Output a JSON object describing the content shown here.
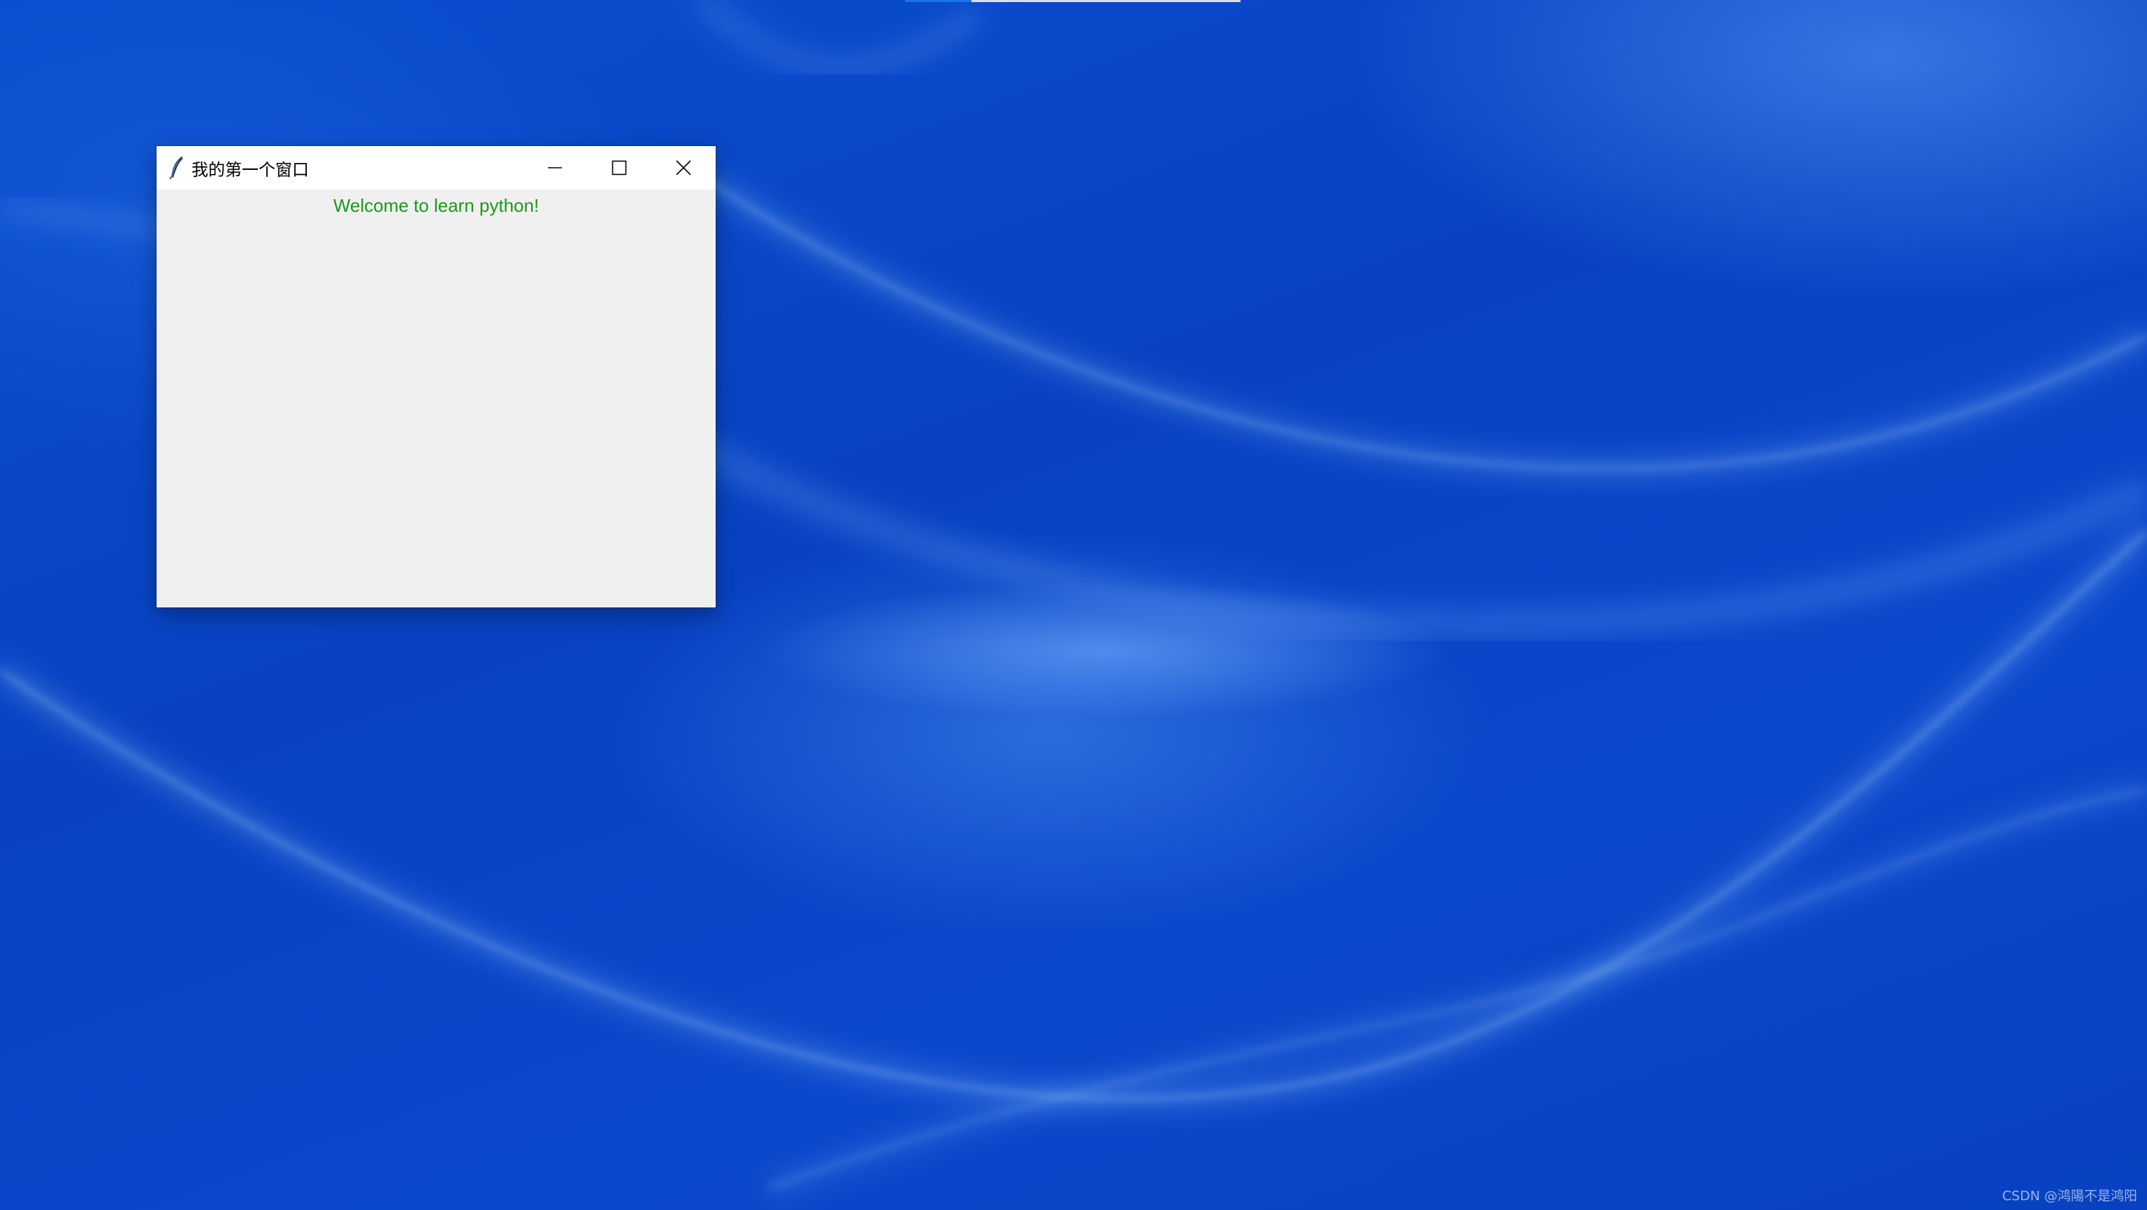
{
  "window": {
    "title": "我的第一个窗口",
    "icon": "tk-feather-icon",
    "buttons": {
      "minimize": "minimize-icon",
      "maximize": "maximize-icon",
      "close": "close-icon"
    },
    "label_text": "Welcome to learn python!",
    "label_color": "#1a9a1a",
    "background_color": "#f0f0f0"
  },
  "desktop": {
    "wallpaper_color": "#0a48cc",
    "watermark": "CSDN @鸿陽不是鸿阳"
  }
}
